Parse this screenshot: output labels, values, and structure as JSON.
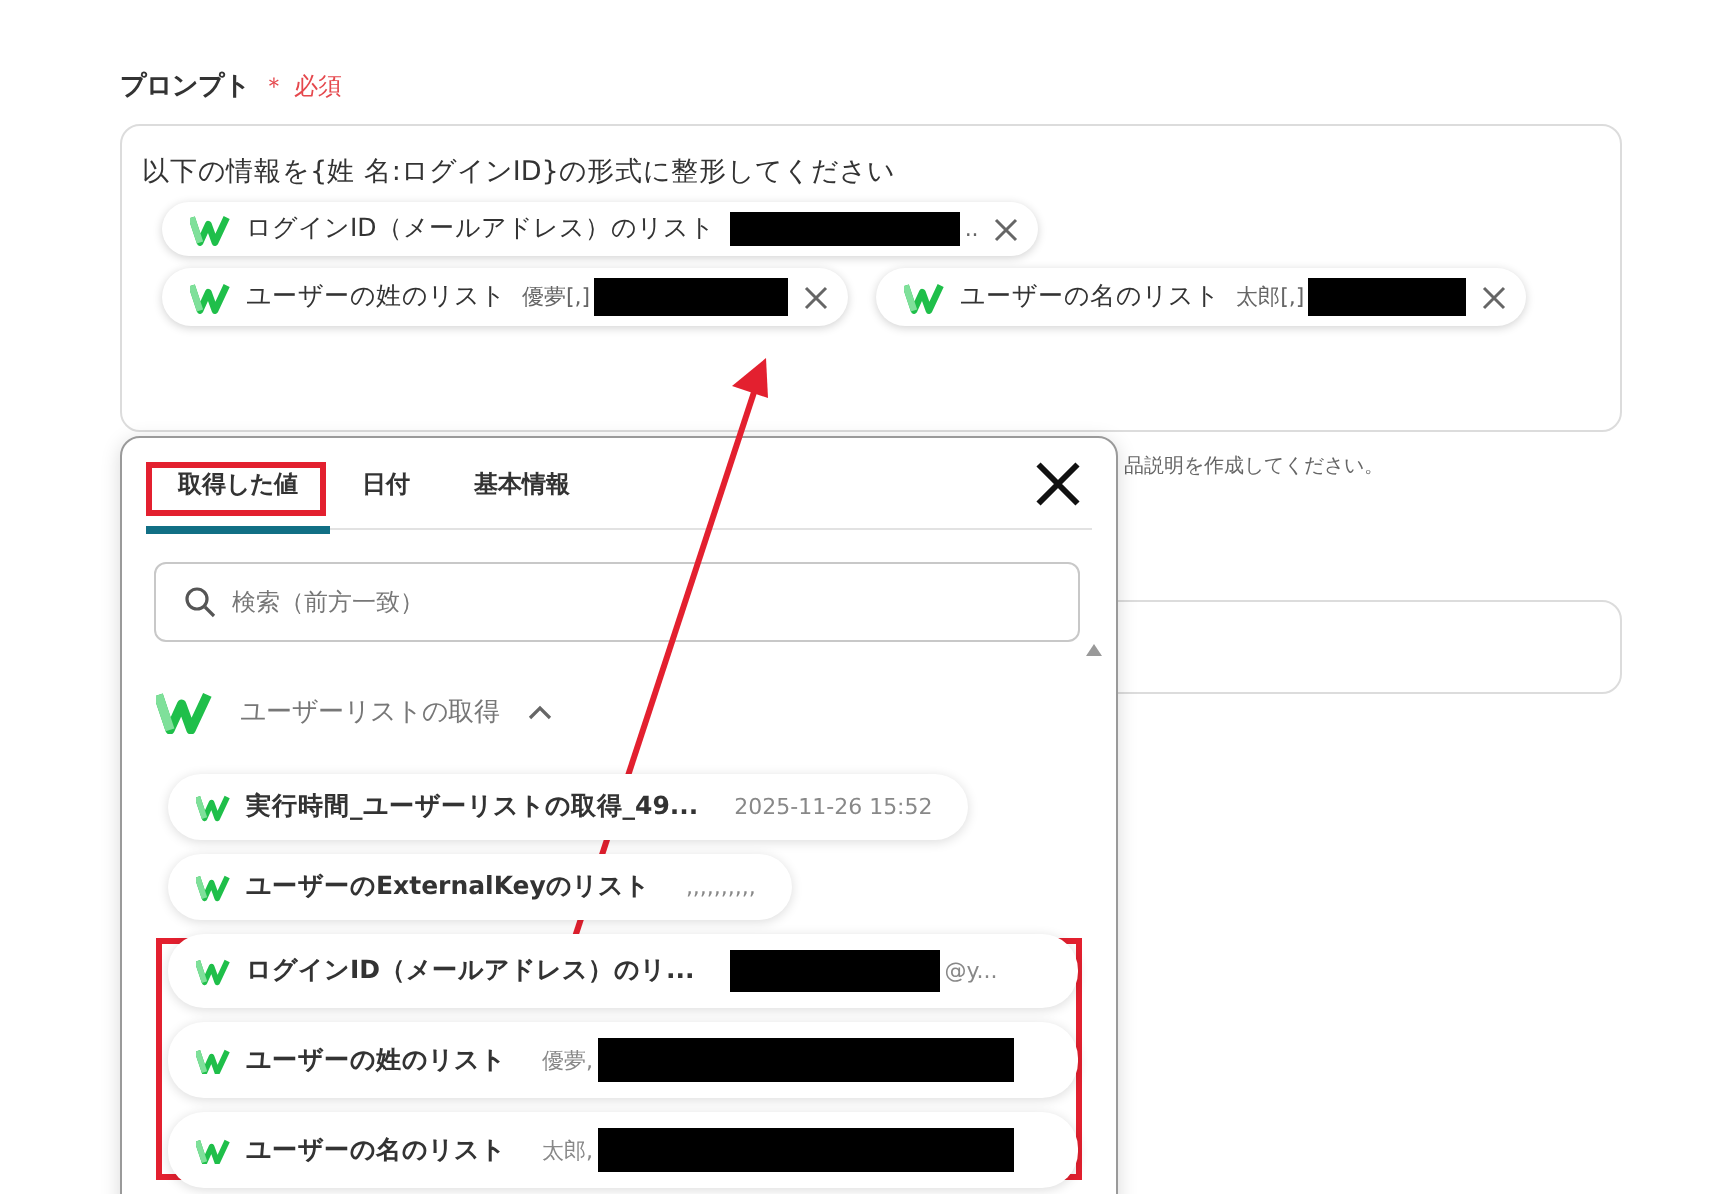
{
  "prompt": {
    "label": "プロンプト",
    "required_mark": "＊",
    "required": "必須",
    "text": "以下の情報を{姓 名:ログインID}の形式に整形してください",
    "chips": [
      {
        "label": "ログインID（メールアドレス）のリスト",
        "preview": ".."
      },
      {
        "label": "ユーザーの姓のリスト",
        "preview": "優夢[,]"
      },
      {
        "label": "ユーザーの名のリスト",
        "preview": "太郎[,]"
      }
    ]
  },
  "hint": "品説明を作成してください。",
  "popup": {
    "tabs": [
      {
        "label": "取得した値",
        "selected": true
      },
      {
        "label": "日付",
        "selected": false
      },
      {
        "label": "基本情報",
        "selected": false
      }
    ],
    "search": {
      "placeholder": "検索（前方一致）"
    },
    "group": {
      "title": "ユーザーリストの取得",
      "expanded": true
    },
    "items": [
      {
        "title": "実行時間_ユーザーリストの取得_49...",
        "preview": "2025-11-26 15:52"
      },
      {
        "title": "ユーザーのExternalKeyのリスト",
        "preview": ",,,,,,,,,,"
      },
      {
        "title": "ログインID（メールアドレス）のリ...",
        "preview": "@y..."
      },
      {
        "title": "ユーザーの姓のリスト",
        "preview": "優夢,"
      },
      {
        "title": "ユーザーの名のリスト",
        "preview": "太郎,"
      }
    ]
  }
}
